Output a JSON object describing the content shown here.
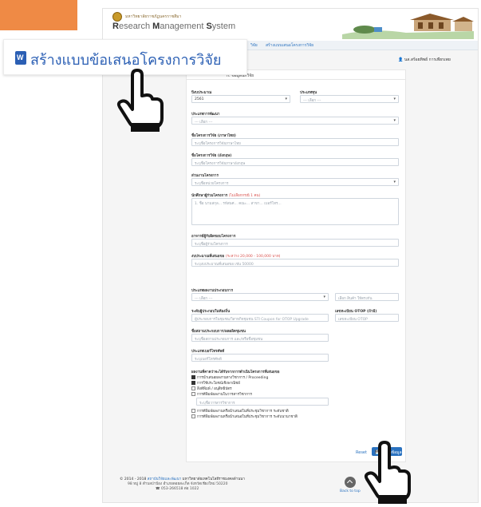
{
  "header": {
    "university": "มหาวิทยาลัยราชภัฏนครราชสีมา",
    "system_prefix_r": "R",
    "system_r": "esearch ",
    "system_m": "M",
    "system_mid": "anagement ",
    "system_s": "S",
    "system_end": "ystem"
  },
  "breadcrumb": {
    "item1": "วิจัย",
    "item2": "สร้างแบบเสนอโครงการวิจัย"
  },
  "user": {
    "name": "นส.สร้อยทิพย์ การเพียรเพย"
  },
  "banner": {
    "title": "สร้างแบบข้อเสนอโครงการวิจัย"
  },
  "form": {
    "card_title": "ก. ข้อมูลนักวิจัย",
    "fiscal_year_label": "ปีงบประมาณ",
    "fiscal_year_value": "2561",
    "fund_type_label": "ประเภททุน",
    "fund_type_value": "--- เลือก ---",
    "research_type_label": "ประเภทการพัฒนา",
    "research_type_value": "--- เลือก ---",
    "name_th_label": "ชื่อโครงการวิจัย (ภาษาไทย)",
    "name_th_placeholder": "ระบุชื่อโครงการวิจัยภาษาไทย",
    "name_en_label": "ชื่อโครงการวิจัย (อังกฤษ)",
    "name_en_placeholder": "ระบุชื่อโครงการวิจัยภาษาอังกฤษ",
    "unit_label": "ส่วนงานโครงการ",
    "unit_value": "ระบุชื่อหน่วยโครงการ",
    "coresearcher_label": "นักศึกษาผู้ร่วมโครงการ",
    "coresearcher_hint": "(ไม่เลือกกรณี 1 คน)",
    "coresearcher_placeholder": "1. ชื่อ นามสกุล... รหัสนศ... คณะ... สาขา... เบอร์โทร...",
    "advisor_label": "อาจารย์ผู้รับผิดชอบโครงการ",
    "advisor_placeholder": "ระบุชื่อผู้ร่วมโครงการ",
    "budget_label": "งบประมาณที่เสนอขอ",
    "budget_hint": "(ระหว่าง 20,000 - 100,000 บาท)",
    "budget_placeholder": "ระบุงบประมาณที่เสนอขอ เช่น 50000",
    "product_type_label": "ประเภทผลงานประกอบการ",
    "product_type_value": "--- เลือก ---",
    "product_search_placeholder": "เลือก สินค้า ให้ตรงกัน",
    "community_label": "ระดับผู้ประกอบในท้องถิ่น",
    "community_placeholder": "ผู้ประกอบการในชุมชน/วิสาหกิจชุมชน STI Coupon for OTOP Upgrade",
    "otop_label": "เลขทะเบียน OTOP (ถ้ามี)",
    "otop_placeholder": "เลขทะเบียน OTOP",
    "entrepreneur_label": "ชื่อสถานประกอบการ/ผลผลิตชุมชน",
    "entrepreneur_placeholder": "ระบุชื่อสถานประกอบการ และ/หรือชื่อชุมชน",
    "phone_label": "ประเภทเบอร์โทรศัพท์",
    "phone_placeholder": "ระบุเบอร์โทรศัพท์",
    "output_label": "ผลงานที่คาดว่าจะได้รับจากการดำเนินโครงการที่เสนอขอ",
    "outputs": [
      "การนำเสนอผลงานทางวิชาการ / Proceeding",
      "การใช้ประโยชน์เชิงพาณิชย์",
      "สิ่งตีพิมพ์ / อนุสิทธิบัตร",
      "การตีพิมพ์ผลงานในวารสารวิชาการ",
      "การตีพิมพ์ผลงานหรือนำเสนอในที่ประชุมวิชาการ ระดับชาติ",
      "การตีพิมพ์ผลงานหรือนำเสนอในที่ประชุมวิชาการ ระดับนานาชาติ"
    ],
    "journal_placeholder": "ระบุชื่อวารสารวิชาการ",
    "reset_label": "Reset",
    "save_label": "💾 บันทึกข้อมูล"
  },
  "footer": {
    "copyright": "© 2014 - 2018",
    "link": "สถาบันวิจัยและพัฒนา",
    "line1_rest": " มหาวิทยาลัยเทคโนโลยีราชมงคลล้านนา",
    "line2": "98 หมู่ 8 ตำบลป่าป้อง อำเภอดอยสะเก็ด จังหวัดเชียงใหม่ 50220",
    "line3": "☎ 053-266518  ต่อ 1022",
    "back_to_top": "Back to top"
  },
  "colors": {
    "accent": "#2a72c0",
    "orange": "#ef8a45",
    "banner_text": "#2b5fb4"
  }
}
